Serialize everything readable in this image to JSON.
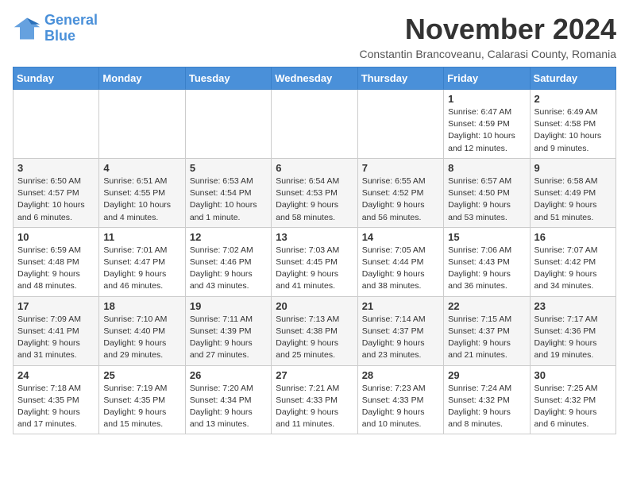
{
  "logo": {
    "line1": "General",
    "line2": "Blue"
  },
  "title": "November 2024",
  "subtitle": "Constantin Brancoveanu, Calarasi County, Romania",
  "headers": [
    "Sunday",
    "Monday",
    "Tuesday",
    "Wednesday",
    "Thursday",
    "Friday",
    "Saturday"
  ],
  "weeks": [
    [
      {
        "day": "",
        "info": ""
      },
      {
        "day": "",
        "info": ""
      },
      {
        "day": "",
        "info": ""
      },
      {
        "day": "",
        "info": ""
      },
      {
        "day": "",
        "info": ""
      },
      {
        "day": "1",
        "info": "Sunrise: 6:47 AM\nSunset: 4:59 PM\nDaylight: 10 hours and 12 minutes."
      },
      {
        "day": "2",
        "info": "Sunrise: 6:49 AM\nSunset: 4:58 PM\nDaylight: 10 hours and 9 minutes."
      }
    ],
    [
      {
        "day": "3",
        "info": "Sunrise: 6:50 AM\nSunset: 4:57 PM\nDaylight: 10 hours and 6 minutes."
      },
      {
        "day": "4",
        "info": "Sunrise: 6:51 AM\nSunset: 4:55 PM\nDaylight: 10 hours and 4 minutes."
      },
      {
        "day": "5",
        "info": "Sunrise: 6:53 AM\nSunset: 4:54 PM\nDaylight: 10 hours and 1 minute."
      },
      {
        "day": "6",
        "info": "Sunrise: 6:54 AM\nSunset: 4:53 PM\nDaylight: 9 hours and 58 minutes."
      },
      {
        "day": "7",
        "info": "Sunrise: 6:55 AM\nSunset: 4:52 PM\nDaylight: 9 hours and 56 minutes."
      },
      {
        "day": "8",
        "info": "Sunrise: 6:57 AM\nSunset: 4:50 PM\nDaylight: 9 hours and 53 minutes."
      },
      {
        "day": "9",
        "info": "Sunrise: 6:58 AM\nSunset: 4:49 PM\nDaylight: 9 hours and 51 minutes."
      }
    ],
    [
      {
        "day": "10",
        "info": "Sunrise: 6:59 AM\nSunset: 4:48 PM\nDaylight: 9 hours and 48 minutes."
      },
      {
        "day": "11",
        "info": "Sunrise: 7:01 AM\nSunset: 4:47 PM\nDaylight: 9 hours and 46 minutes."
      },
      {
        "day": "12",
        "info": "Sunrise: 7:02 AM\nSunset: 4:46 PM\nDaylight: 9 hours and 43 minutes."
      },
      {
        "day": "13",
        "info": "Sunrise: 7:03 AM\nSunset: 4:45 PM\nDaylight: 9 hours and 41 minutes."
      },
      {
        "day": "14",
        "info": "Sunrise: 7:05 AM\nSunset: 4:44 PM\nDaylight: 9 hours and 38 minutes."
      },
      {
        "day": "15",
        "info": "Sunrise: 7:06 AM\nSunset: 4:43 PM\nDaylight: 9 hours and 36 minutes."
      },
      {
        "day": "16",
        "info": "Sunrise: 7:07 AM\nSunset: 4:42 PM\nDaylight: 9 hours and 34 minutes."
      }
    ],
    [
      {
        "day": "17",
        "info": "Sunrise: 7:09 AM\nSunset: 4:41 PM\nDaylight: 9 hours and 31 minutes."
      },
      {
        "day": "18",
        "info": "Sunrise: 7:10 AM\nSunset: 4:40 PM\nDaylight: 9 hours and 29 minutes."
      },
      {
        "day": "19",
        "info": "Sunrise: 7:11 AM\nSunset: 4:39 PM\nDaylight: 9 hours and 27 minutes."
      },
      {
        "day": "20",
        "info": "Sunrise: 7:13 AM\nSunset: 4:38 PM\nDaylight: 9 hours and 25 minutes."
      },
      {
        "day": "21",
        "info": "Sunrise: 7:14 AM\nSunset: 4:37 PM\nDaylight: 9 hours and 23 minutes."
      },
      {
        "day": "22",
        "info": "Sunrise: 7:15 AM\nSunset: 4:37 PM\nDaylight: 9 hours and 21 minutes."
      },
      {
        "day": "23",
        "info": "Sunrise: 7:17 AM\nSunset: 4:36 PM\nDaylight: 9 hours and 19 minutes."
      }
    ],
    [
      {
        "day": "24",
        "info": "Sunrise: 7:18 AM\nSunset: 4:35 PM\nDaylight: 9 hours and 17 minutes."
      },
      {
        "day": "25",
        "info": "Sunrise: 7:19 AM\nSunset: 4:35 PM\nDaylight: 9 hours and 15 minutes."
      },
      {
        "day": "26",
        "info": "Sunrise: 7:20 AM\nSunset: 4:34 PM\nDaylight: 9 hours and 13 minutes."
      },
      {
        "day": "27",
        "info": "Sunrise: 7:21 AM\nSunset: 4:33 PM\nDaylight: 9 hours and 11 minutes."
      },
      {
        "day": "28",
        "info": "Sunrise: 7:23 AM\nSunset: 4:33 PM\nDaylight: 9 hours and 10 minutes."
      },
      {
        "day": "29",
        "info": "Sunrise: 7:24 AM\nSunset: 4:32 PM\nDaylight: 9 hours and 8 minutes."
      },
      {
        "day": "30",
        "info": "Sunrise: 7:25 AM\nSunset: 4:32 PM\nDaylight: 9 hours and 6 minutes."
      }
    ]
  ]
}
